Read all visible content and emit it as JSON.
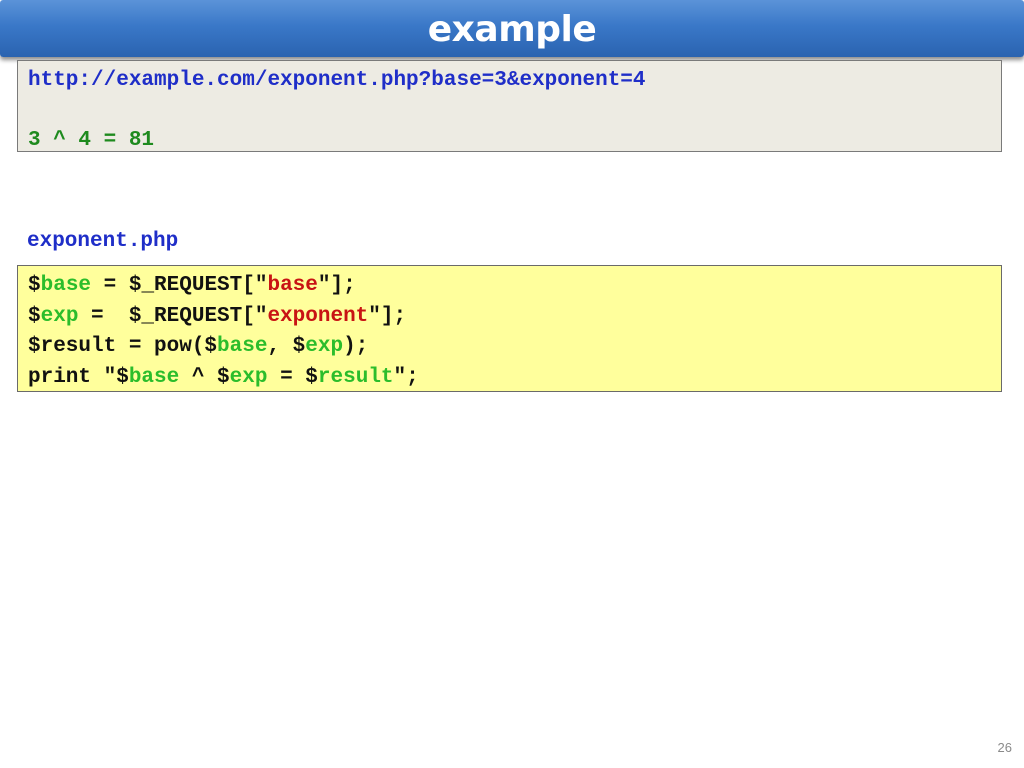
{
  "slide": {
    "title": "example",
    "page_number": "26"
  },
  "output": {
    "url": "http://example.com/exponent.php?base=3&exponent=4",
    "result": "3 ^ 4 = 81"
  },
  "file": {
    "name": "exponent.php"
  },
  "code": {
    "line1": {
      "d1": "$",
      "v1": "base",
      "t1": " = $_REQUEST[\"",
      "s1": "base",
      "t2": "\"];"
    },
    "line2": {
      "d1": "$",
      "v1": "exp",
      "t1": " =  $_REQUEST[\"",
      "s1": "exponent",
      "t2": "\"];"
    },
    "line3": {
      "t1": "$result = pow($",
      "v1": "base",
      "t2": ", $",
      "v2": "exp",
      "t3": ");"
    },
    "line4": {
      "t1": "print \"$",
      "v1": "base",
      "t2": " ^ $",
      "v2": "exp",
      "t3": " = $",
      "v3": "result",
      "t4": "\";"
    }
  },
  "colors": {
    "title_bar": "#3a78c8",
    "url_text": "#1f2ec8",
    "result_text": "#1e8a1e",
    "variable": "#2bbd2b",
    "string_literal": "#c81414",
    "code_background": "#ffff9c",
    "output_background": "#edebe3"
  }
}
